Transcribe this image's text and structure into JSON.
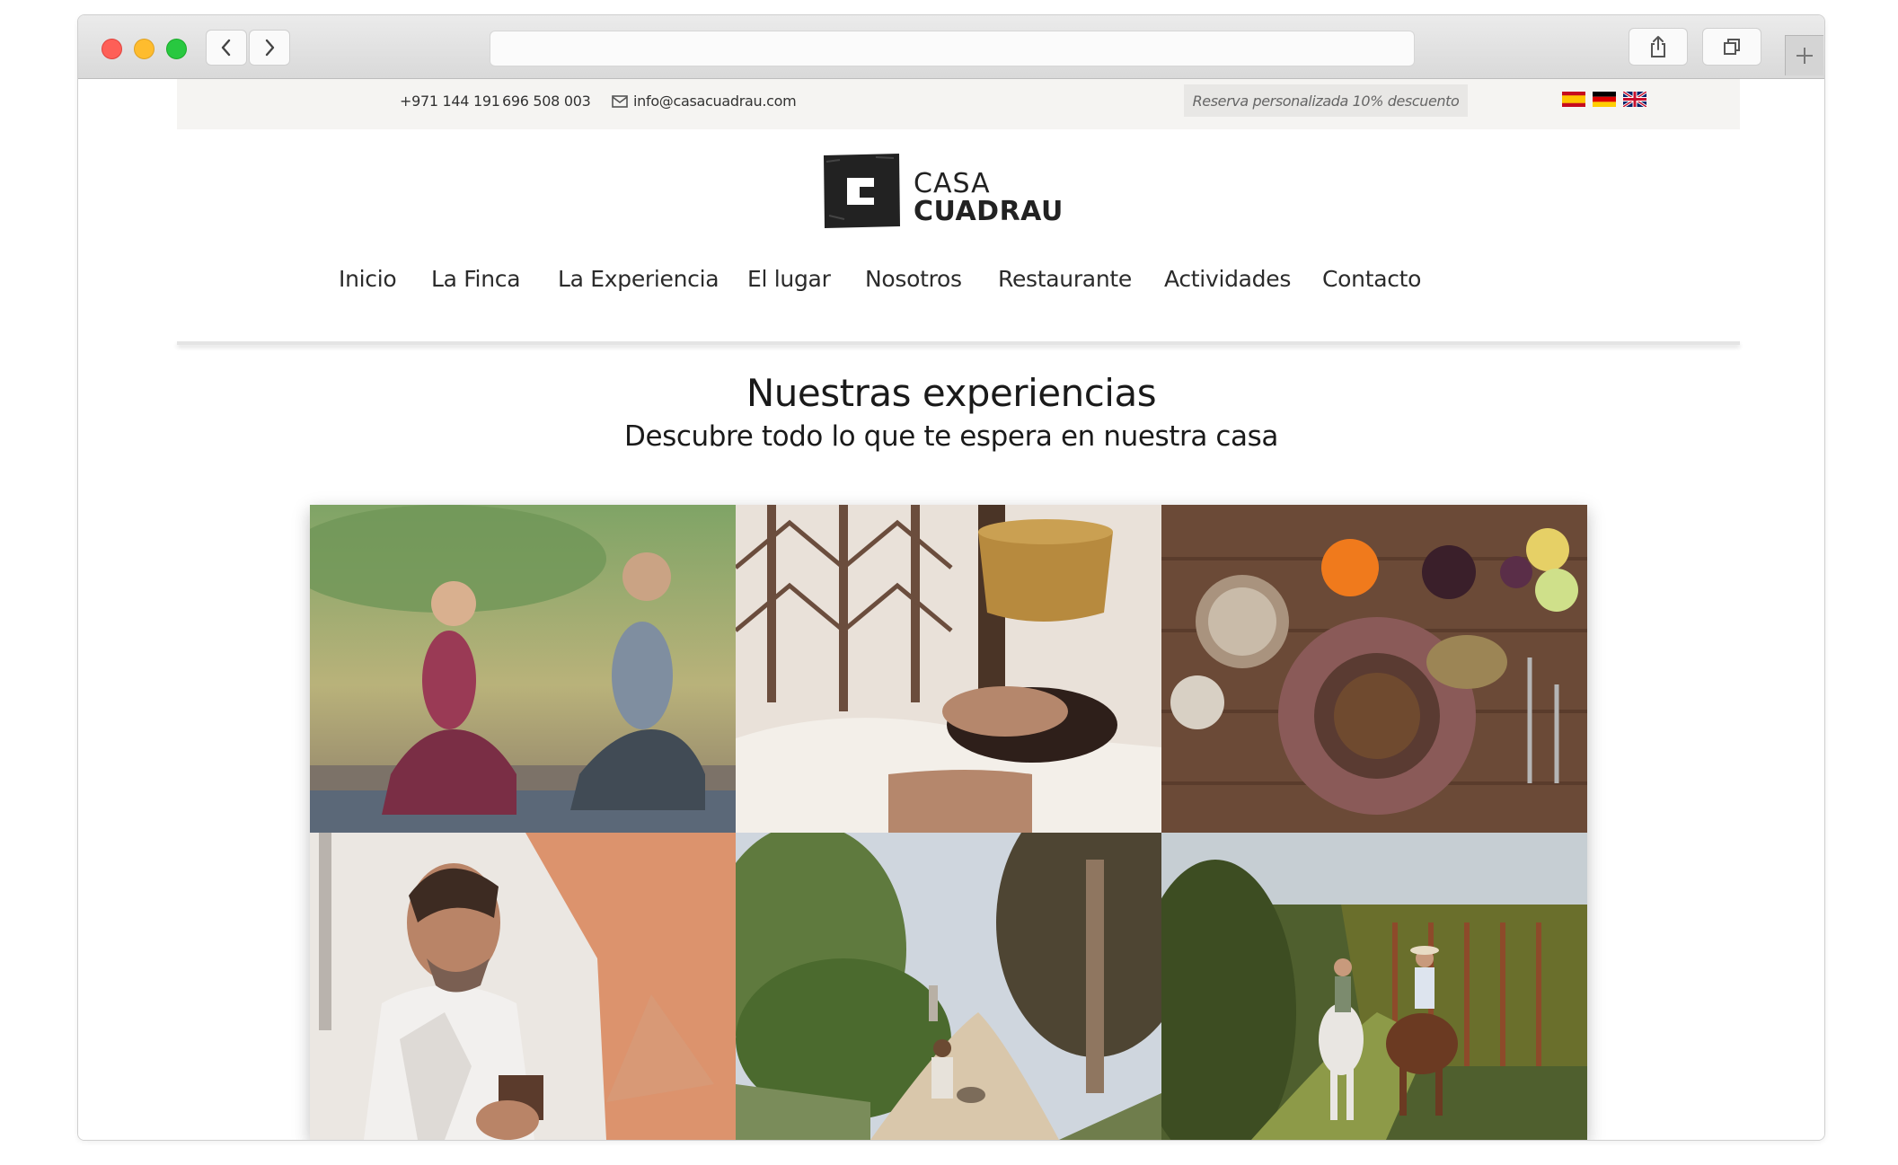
{
  "browser": {
    "url": "",
    "icons": [
      "chevron-left-icon",
      "chevron-right-icon",
      "share-icon",
      "tabs-icon",
      "plus-icon"
    ]
  },
  "topbar": {
    "phone1": "+971 144 191",
    "phone2": "696 508 003",
    "email": "info@casacuadrau.com",
    "promo": "Reserva personalizada 10% descuento",
    "flags": [
      "spanish-flag",
      "german-flag",
      "english-flag"
    ]
  },
  "logo": {
    "line1": "CASA",
    "line2": "CUADRAU"
  },
  "nav": {
    "items": [
      "Inicio",
      "La Finca",
      "La Experiencia",
      "El lugar",
      "Nosotros",
      "Restaurante",
      "Actividades",
      "Contacto"
    ]
  },
  "main": {
    "title": "Nuestras experiencias",
    "subtitle": "Descubre todo lo que te espera en nuestra casa"
  },
  "colors": {
    "topbar_bg": "#f5f4f2",
    "promo_bg": "#e8e7e5",
    "text": "#2b2b2b"
  }
}
